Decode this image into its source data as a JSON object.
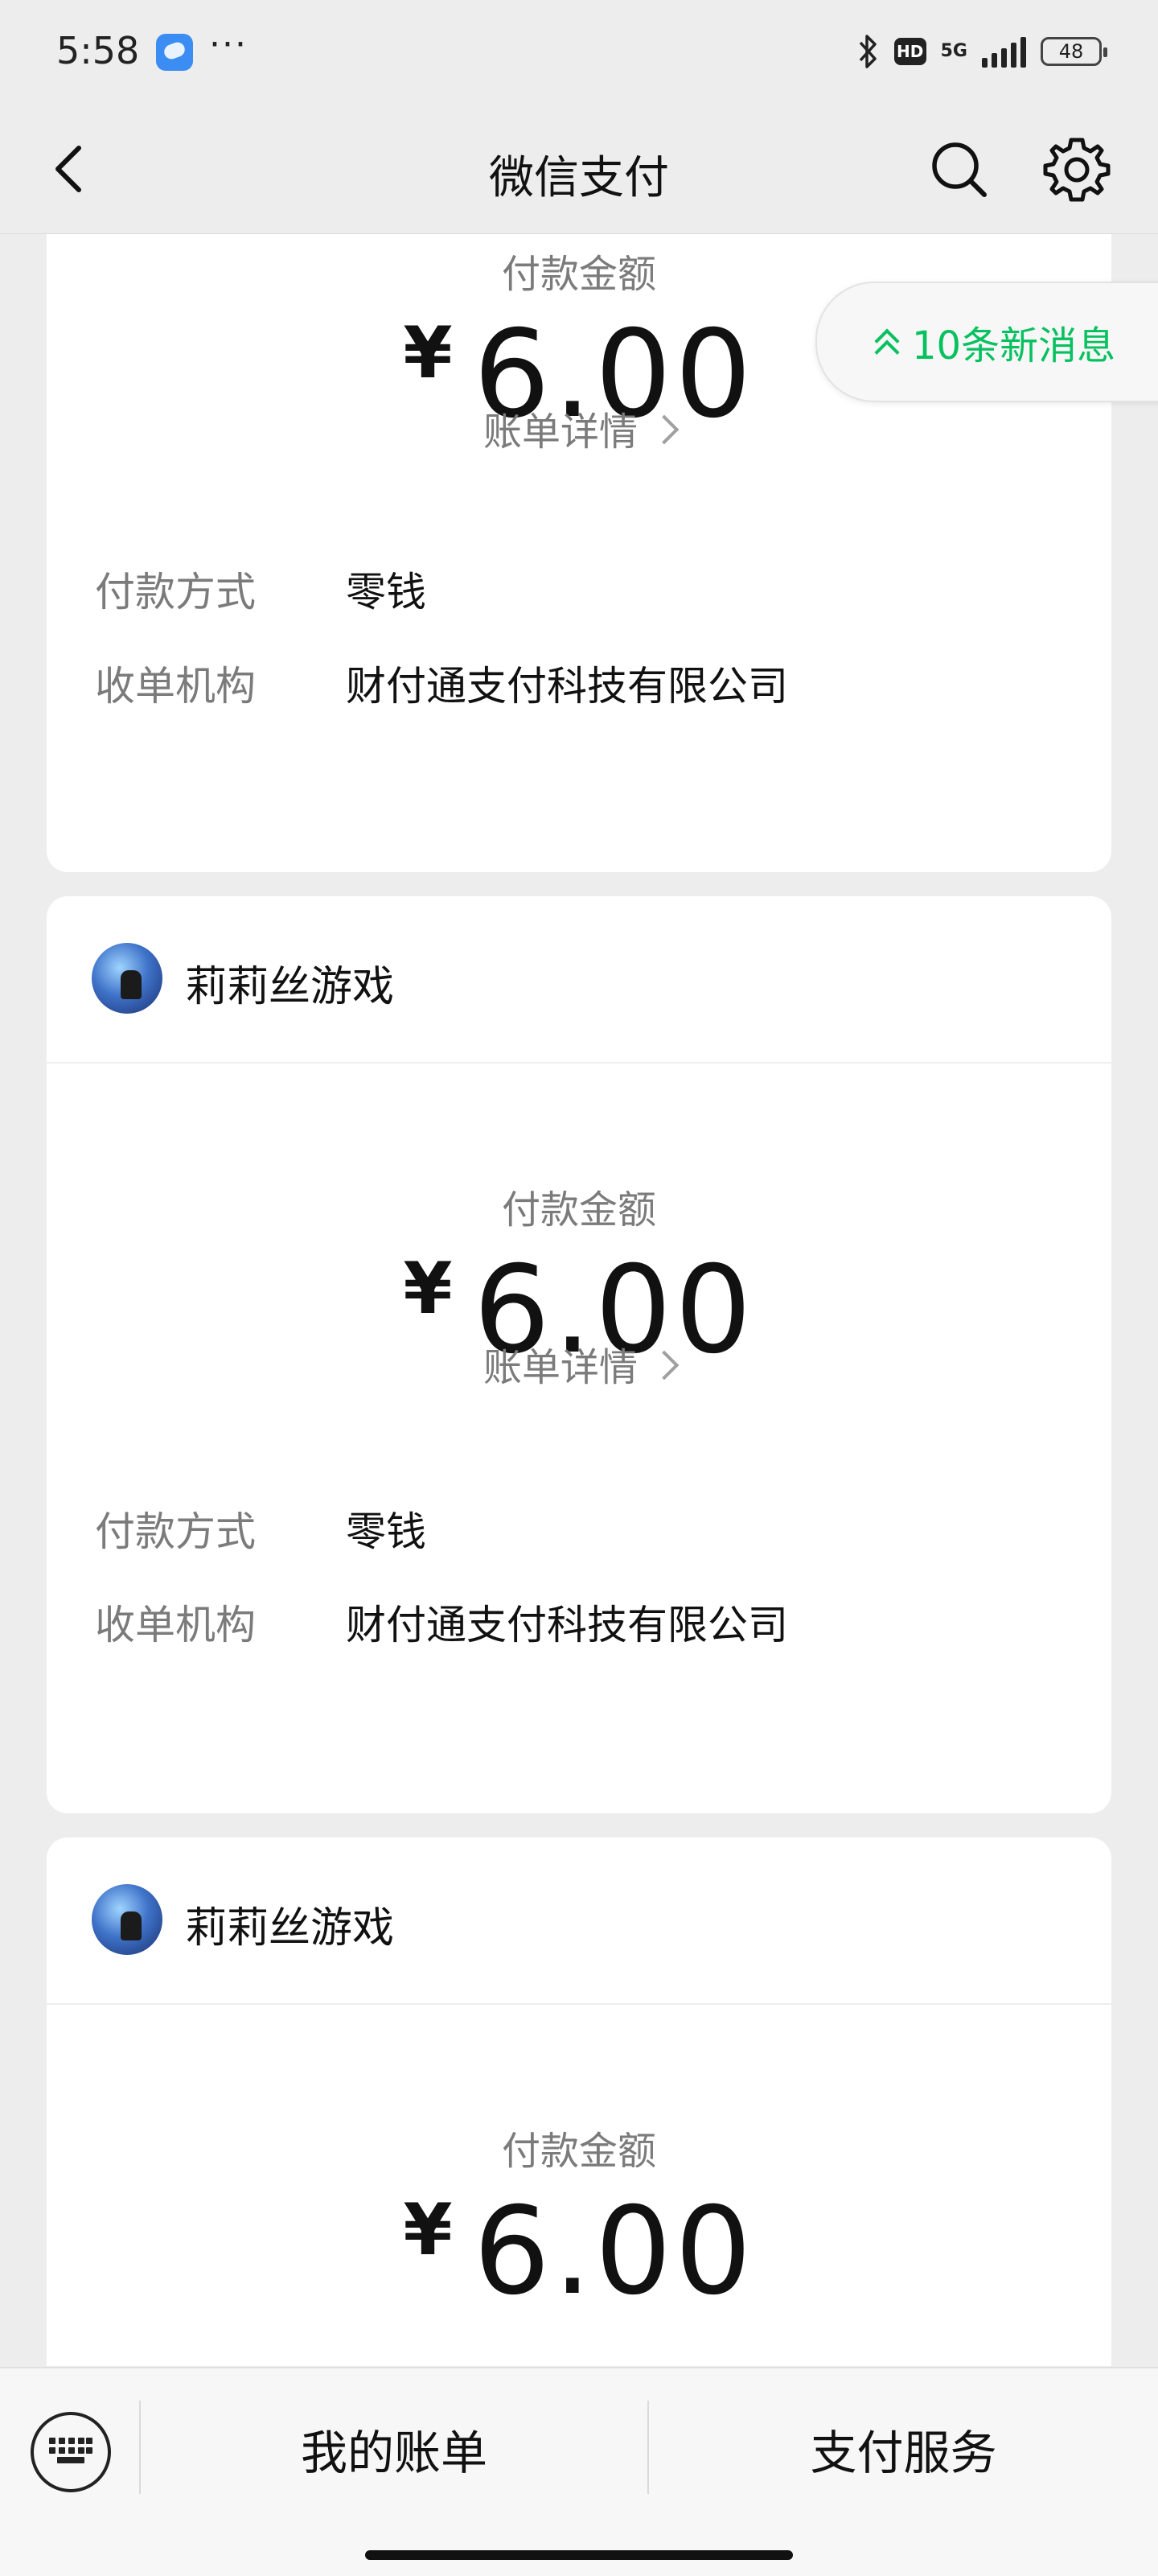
{
  "status_bar": {
    "time": "5:58",
    "dots": "···",
    "hd": "HD",
    "network": "5G",
    "battery": "48"
  },
  "nav": {
    "title": "微信支付"
  },
  "new_messages": {
    "label": "10条新消息"
  },
  "cards": [
    {
      "merchant": "",
      "amount_label": "付款金额",
      "currency": "¥",
      "amount": "6.00",
      "detail": "账单详情",
      "rows": [
        {
          "k": "付款方式",
          "v": "零钱"
        },
        {
          "k": "收单机构",
          "v": "财付通支付科技有限公司"
        }
      ]
    },
    {
      "merchant": "莉莉丝游戏",
      "amount_label": "付款金额",
      "currency": "¥",
      "amount": "6.00",
      "detail": "账单详情",
      "rows": [
        {
          "k": "付款方式",
          "v": "零钱"
        },
        {
          "k": "收单机构",
          "v": "财付通支付科技有限公司"
        }
      ]
    },
    {
      "merchant": "莉莉丝游戏",
      "amount_label": "付款金额",
      "currency": "¥",
      "amount": "6.00"
    }
  ],
  "bottom": {
    "my_bills": "我的账单",
    "pay_services": "支付服务"
  },
  "icons": {
    "back": "back-arrow-icon",
    "search": "search-icon",
    "settings": "gear-icon",
    "keyboard": "keyboard-icon",
    "new_messages": "double-chevron-up-icon"
  },
  "colors": {
    "accent": "#07c160",
    "background": "#ededed",
    "card": "#ffffff"
  }
}
